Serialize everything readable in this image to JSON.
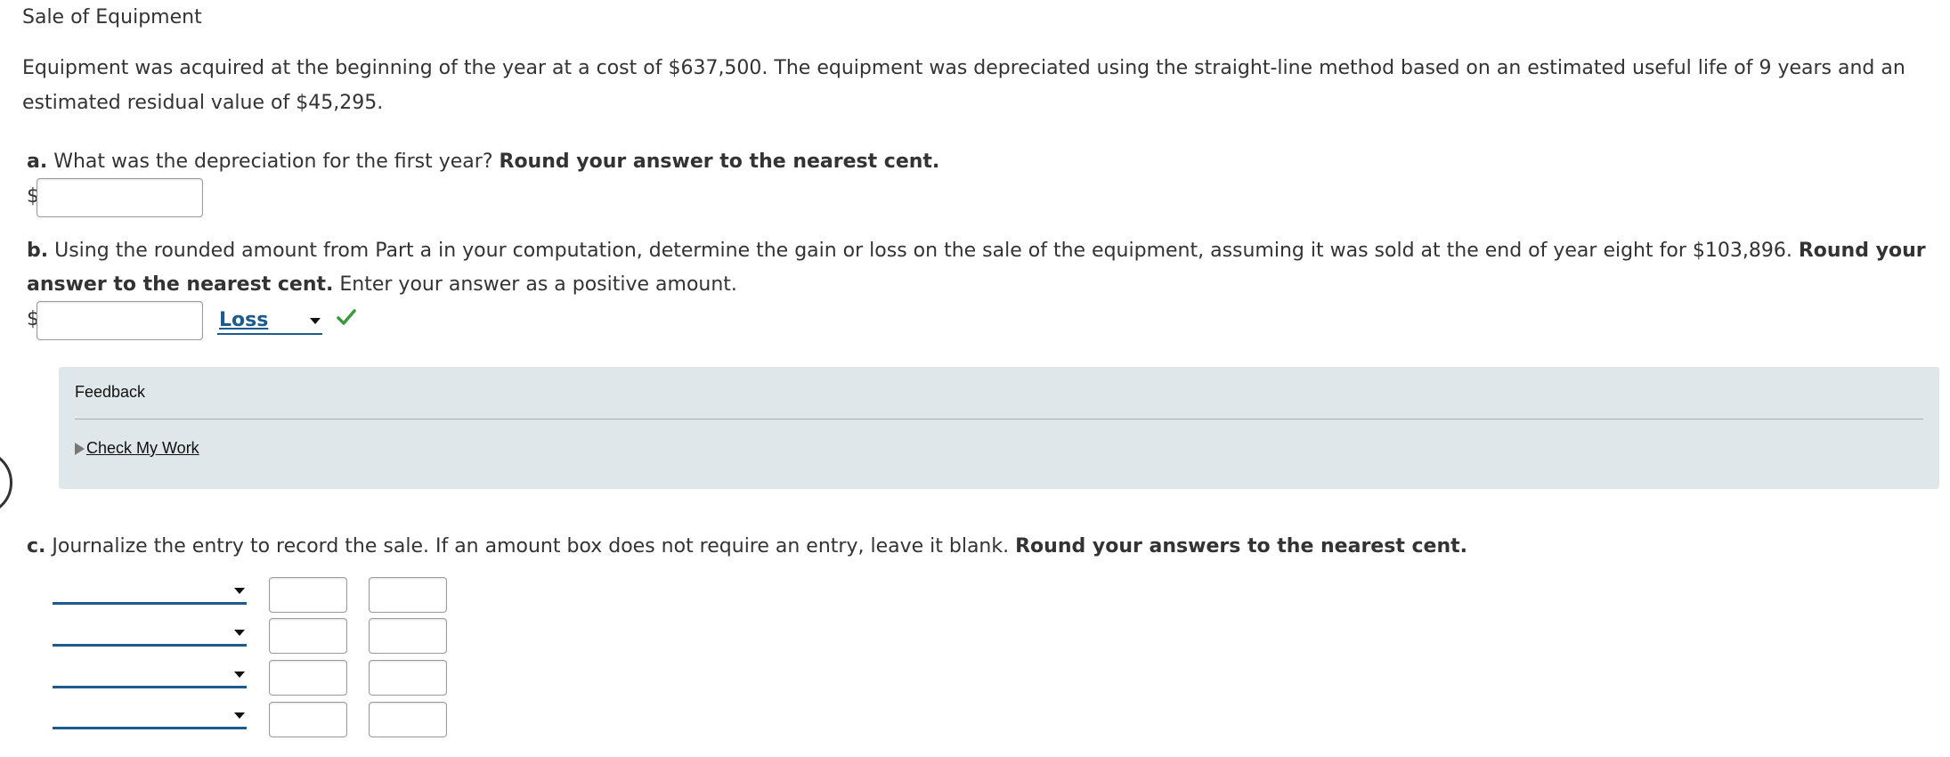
{
  "title": "Sale of Equipment",
  "intro": "Equipment was acquired at the beginning of the year at a cost of $637,500. The equipment was depreciated using the straight-line method based on an estimated useful life of 9 years and an estimated residual value of $45,295.",
  "part_a": {
    "letter": "a.",
    "question": "What was the depreciation for the first year?",
    "instruction": "Round your answer to the nearest cent.",
    "currency": "$",
    "value": ""
  },
  "part_b": {
    "letter": "b.",
    "question": "Using the rounded amount from Part a in your computation, determine the gain or loss on the sale of the equipment, assuming it was sold at the end of year eight for $103,896.",
    "instruction": "Round your answer to the nearest cent.",
    "note": "Enter your answer as a positive amount.",
    "currency": "$",
    "value": "",
    "selected": "Loss",
    "status_icon": "check-icon"
  },
  "feedback": {
    "label": "Feedback",
    "link": "Check My Work"
  },
  "part_c": {
    "letter": "c.",
    "question": "Journalize the entry to record the sale. If an amount box does not require an entry, leave it blank.",
    "instruction": "Round your answers to the nearest cent.",
    "rows": [
      {
        "account": "",
        "debit": "",
        "credit": ""
      },
      {
        "account": "",
        "debit": "",
        "credit": ""
      },
      {
        "account": "",
        "debit": "",
        "credit": ""
      },
      {
        "account": "",
        "debit": "",
        "credit": ""
      }
    ]
  },
  "colors": {
    "link_blue": "#1d5b8f",
    "check_green": "#3c9a3c",
    "feedback_bg": "#dfe7ea",
    "text": "#333333"
  }
}
